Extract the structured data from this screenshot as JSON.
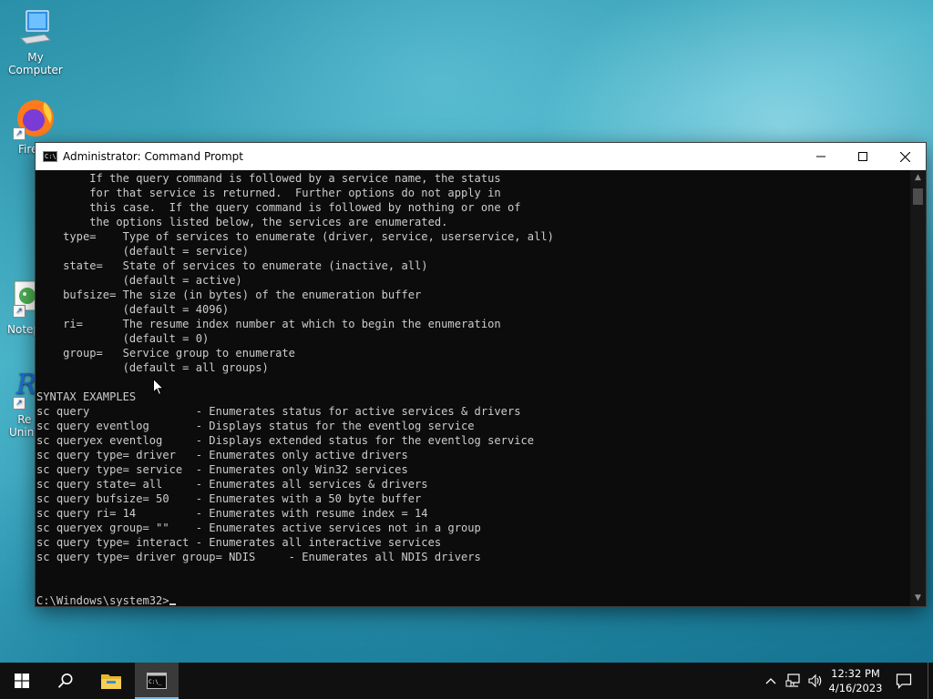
{
  "desktop": {
    "icons": [
      {
        "label": "My Computer",
        "icon": "computer-icon"
      },
      {
        "label": "Fire",
        "icon": "firefox-icon"
      },
      {
        "label": "Notep",
        "icon": "notepad-icon"
      },
      {
        "label": "Re\nUnins",
        "icon": "uninstaller-icon"
      }
    ]
  },
  "window": {
    "title": "Administrator: Command Prompt",
    "icon": "console-icon",
    "buttons": {
      "minimize": "─",
      "maximize": "☐",
      "close": "✕"
    }
  },
  "console": {
    "lines": [
      "        If the query command is followed by a service name, the status",
      "        for that service is returned.  Further options do not apply in",
      "        this case.  If the query command is followed by nothing or one of",
      "        the options listed below, the services are enumerated.",
      "    type=    Type of services to enumerate (driver, service, userservice, all)",
      "             (default = service)",
      "    state=   State of services to enumerate (inactive, all)",
      "             (default = active)",
      "    bufsize= The size (in bytes) of the enumeration buffer",
      "             (default = 4096)",
      "    ri=      The resume index number at which to begin the enumeration",
      "             (default = 0)",
      "    group=   Service group to enumerate",
      "             (default = all groups)",
      "",
      "SYNTAX EXAMPLES",
      "sc query                - Enumerates status for active services & drivers",
      "sc query eventlog       - Displays status for the eventlog service",
      "sc queryex eventlog     - Displays extended status for the eventlog service",
      "sc query type= driver   - Enumerates only active drivers",
      "sc query type= service  - Enumerates only Win32 services",
      "sc query state= all     - Enumerates all services & drivers",
      "sc query bufsize= 50    - Enumerates with a 50 byte buffer",
      "sc query ri= 14         - Enumerates with resume index = 14",
      "sc queryex group= \"\"    - Enumerates active services not in a group",
      "sc query type= interact - Enumerates all interactive services",
      "sc query type= driver group= NDIS     - Enumerates all NDIS drivers",
      "",
      ""
    ],
    "prompt": "C:\\Windows\\system32>"
  },
  "taskbar": {
    "start_icon": "windows-start-icon",
    "search_icon": "search-icon",
    "pinned": [
      {
        "name": "file-explorer",
        "icon": "folder-icon",
        "active": false
      },
      {
        "name": "command-prompt",
        "icon": "console-icon",
        "active": true
      }
    ],
    "tray": {
      "chevron": "^",
      "time": "12:32 PM",
      "date": "4/16/2023"
    }
  }
}
